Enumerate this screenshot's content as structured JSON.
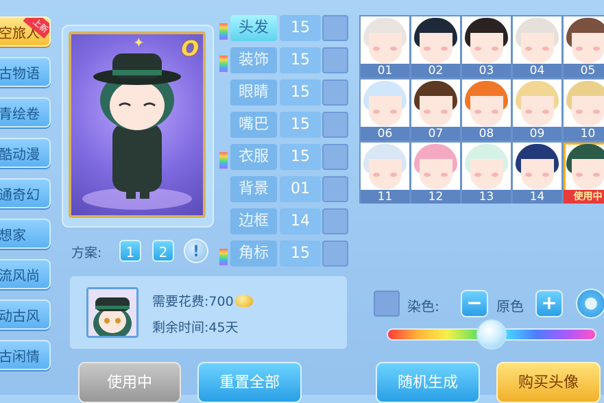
{
  "sidebar": {
    "items": [
      {
        "label": "空旅人",
        "active": true,
        "badge": "上新"
      },
      {
        "label": "古物语"
      },
      {
        "label": "青绘卷"
      },
      {
        "label": "酷动漫"
      },
      {
        "label": "通奇幻"
      },
      {
        "label": "想家"
      },
      {
        "label": "流风尚"
      },
      {
        "label": "动古风"
      },
      {
        "label": "古闲情"
      }
    ]
  },
  "card": {
    "rank": "O"
  },
  "scheme": {
    "label": "方案:",
    "buttons": [
      "1",
      "2"
    ],
    "info": "!"
  },
  "categories": [
    {
      "label": "头发",
      "value": "15",
      "active": true
    },
    {
      "label": "装饰",
      "value": "15"
    },
    {
      "label": "眼睛",
      "value": "15"
    },
    {
      "label": "嘴巴",
      "value": "15"
    },
    {
      "label": "衣服",
      "value": "15"
    },
    {
      "label": "背景",
      "value": "01"
    },
    {
      "label": "边框",
      "value": "14"
    },
    {
      "label": "角标",
      "value": "15"
    }
  ],
  "hair_grid": {
    "items": [
      {
        "num": "01",
        "color": "#e9e4df"
      },
      {
        "num": "02",
        "color": "#1e2a3a"
      },
      {
        "num": "03",
        "color": "#2b2321"
      },
      {
        "num": "04",
        "color": "#e6e0da"
      },
      {
        "num": "05",
        "color": "#7b5140"
      },
      {
        "num": "06",
        "color": "#cfe6fb"
      },
      {
        "num": "07",
        "color": "#5e3a22"
      },
      {
        "num": "08",
        "color": "#f0772a"
      },
      {
        "num": "09",
        "color": "#f2d694"
      },
      {
        "num": "10",
        "color": "#ead08a"
      },
      {
        "num": "11",
        "color": "#d9e6f4"
      },
      {
        "num": "12",
        "color": "#f4a8c2"
      },
      {
        "num": "13",
        "color": "#d6f2e6"
      },
      {
        "num": "14",
        "color": "#233a7a"
      },
      {
        "num": "",
        "color": "#2c5c48",
        "using": true,
        "using_label": "使用中"
      }
    ]
  },
  "cost": {
    "cost_label": "需要花费:",
    "cost_value": "700",
    "time_label": "剩余时间:",
    "time_value": "45天"
  },
  "dye": {
    "label": "染色:",
    "value": "原色",
    "minus": "−",
    "plus": "+"
  },
  "slider": {
    "level": 0.5
  },
  "buttons": {
    "using": "使用中",
    "reset": "重置全部",
    "random": "随机生成",
    "buy": "购买头像"
  }
}
